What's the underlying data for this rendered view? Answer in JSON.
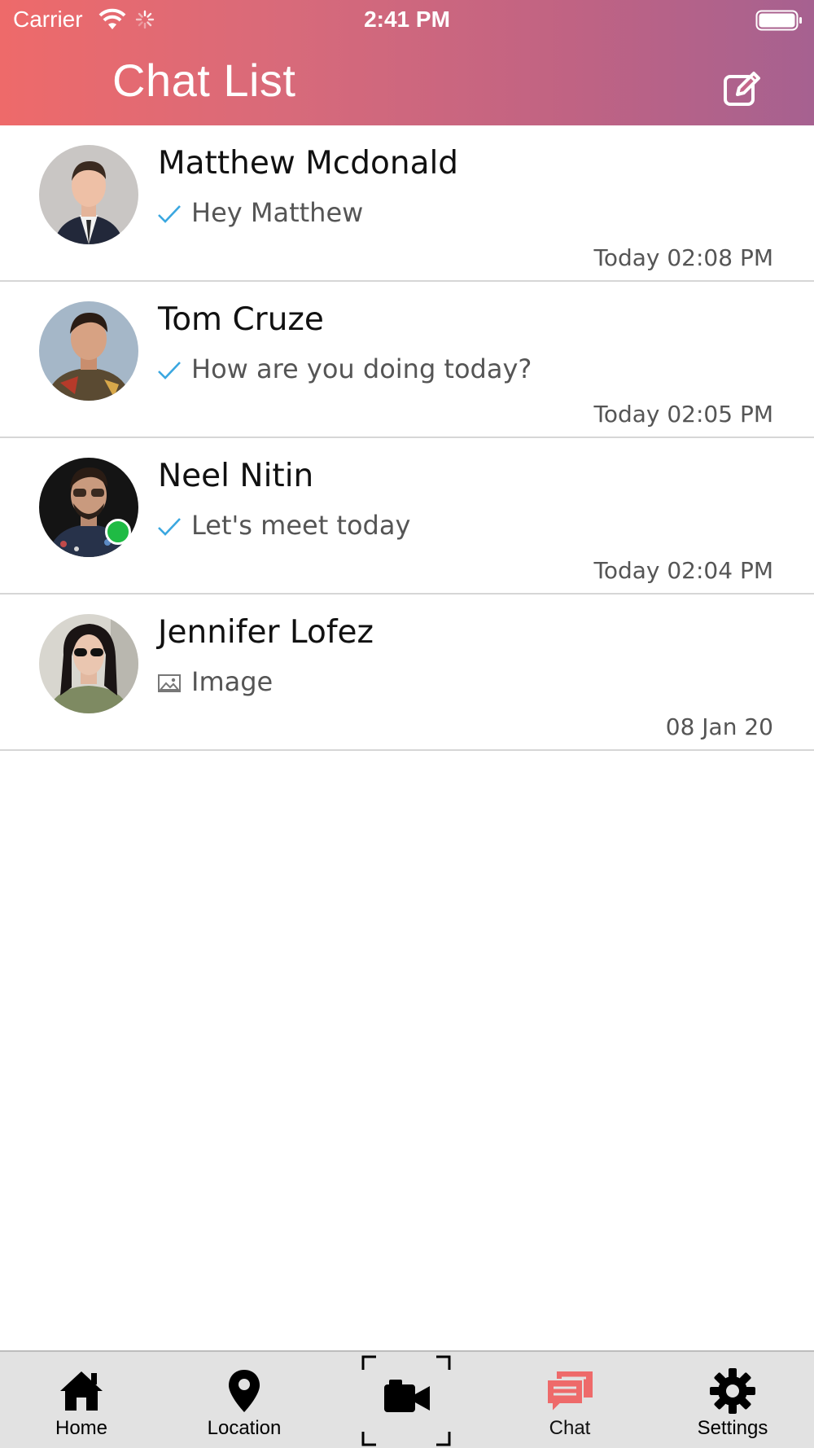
{
  "status_bar": {
    "carrier": "Carrier",
    "time": "2:41 PM",
    "icons": [
      "wifi-icon",
      "activity-spinner-icon",
      "battery-icon"
    ]
  },
  "header": {
    "title": "Chat List",
    "compose_icon": "compose-icon"
  },
  "chats": [
    {
      "name": "Matthew Mcdonald",
      "message": "Hey Matthew",
      "message_icon": "check-icon",
      "time": "Today 02:08 PM",
      "online": false
    },
    {
      "name": "Tom Cruze",
      "message": "How are you doing today?",
      "message_icon": "check-icon",
      "time": "Today 02:05 PM",
      "online": false
    },
    {
      "name": "Neel Nitin",
      "message": "Let's meet today",
      "message_icon": "check-icon",
      "time": "Today 02:04 PM",
      "online": true
    },
    {
      "name": "Jennifer Lofez",
      "message": "Image",
      "message_icon": "image-icon",
      "time": "08 Jan 20",
      "online": false
    }
  ],
  "tabbar": {
    "items": [
      {
        "label": "Home",
        "icon": "home-icon"
      },
      {
        "label": "Location",
        "icon": "location-pin-icon"
      },
      {
        "label": "",
        "icon": "video-camera-icon"
      },
      {
        "label": "Chat",
        "icon": "chat-icon",
        "active": true
      },
      {
        "label": "Settings",
        "icon": "gear-icon"
      }
    ]
  },
  "colors": {
    "header_gradient_start": "#ee6a6a",
    "header_gradient_end": "#a66190",
    "check": "#3aa7e0",
    "online": "#1fbb44",
    "active_tab": "#ee6a6a",
    "tabbar_bg": "#e2e2e2"
  }
}
